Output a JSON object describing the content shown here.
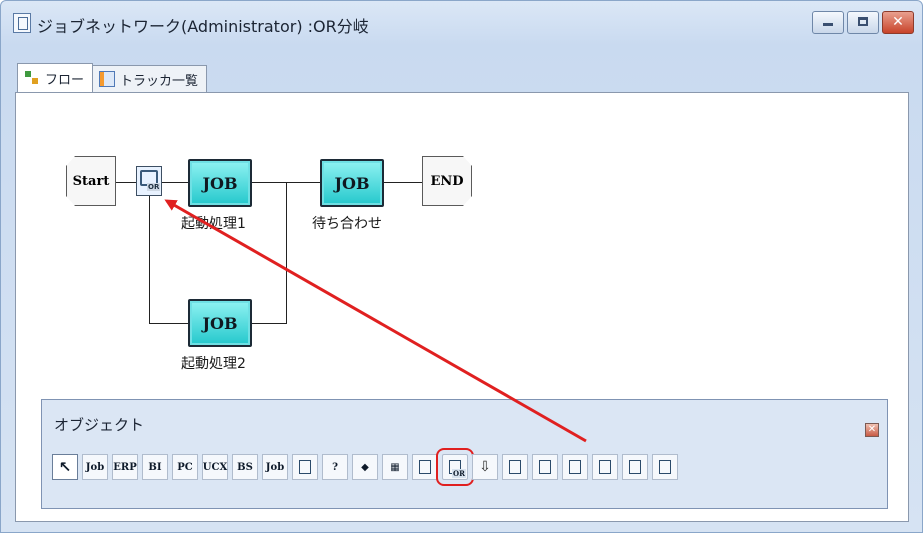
{
  "window": {
    "title": "ジョブネットワーク(Administrator) :OR分岐",
    "min_label": "_",
    "max_label": "□",
    "close_label": "✕"
  },
  "tabs": [
    {
      "label": "フロー",
      "icon": "flow-icon",
      "active": true
    },
    {
      "label": "トラッカ一覧",
      "icon": "tracker-list-icon",
      "active": false
    }
  ],
  "flow": {
    "start_label": "Start",
    "end_label": "END",
    "or_label": "OR",
    "jobs": [
      {
        "label": "JOB",
        "caption": "起動処理1"
      },
      {
        "label": "JOB",
        "caption": "待ち合わせ"
      },
      {
        "label": "JOB",
        "caption": "起動処理2"
      }
    ]
  },
  "palette": {
    "title": "オブジェクト",
    "close_label": "✕",
    "tools": [
      {
        "label": "↖",
        "icon": "pointer-icon"
      },
      {
        "label": "Job",
        "icon": "job-icon"
      },
      {
        "label": "ERP",
        "icon": "erp-icon"
      },
      {
        "label": "BI",
        "icon": "bi-icon"
      },
      {
        "label": "PC",
        "icon": "pc-icon"
      },
      {
        "label": "UCX",
        "icon": "ucx-icon"
      },
      {
        "label": "BS",
        "icon": "bs-icon"
      },
      {
        "label": "Job",
        "icon": "job-group-icon"
      },
      {
        "label": "",
        "icon": "dialog-icon"
      },
      {
        "label": "?",
        "icon": "condition-icon"
      },
      {
        "label": "◆",
        "icon": "branch-icon"
      },
      {
        "label": "▦",
        "icon": "calendar-icon"
      },
      {
        "label": "",
        "icon": "parallel-icon"
      },
      {
        "label": "OR",
        "icon": "or-branch-icon"
      },
      {
        "label": "⇩",
        "icon": "flow-down-icon"
      },
      {
        "label": "",
        "icon": "wait-jobnet-icon"
      },
      {
        "label": "",
        "icon": "wait-job-icon"
      },
      {
        "label": "",
        "icon": "wait-file-icon"
      },
      {
        "label": "",
        "icon": "wait-time-icon"
      },
      {
        "label": "",
        "icon": "event-send-icon"
      },
      {
        "label": "",
        "icon": "event-receive-icon"
      }
    ]
  },
  "colors": {
    "job_fill": "#24c8cc",
    "arrow": "#e02020",
    "highlight": "#e02020"
  }
}
